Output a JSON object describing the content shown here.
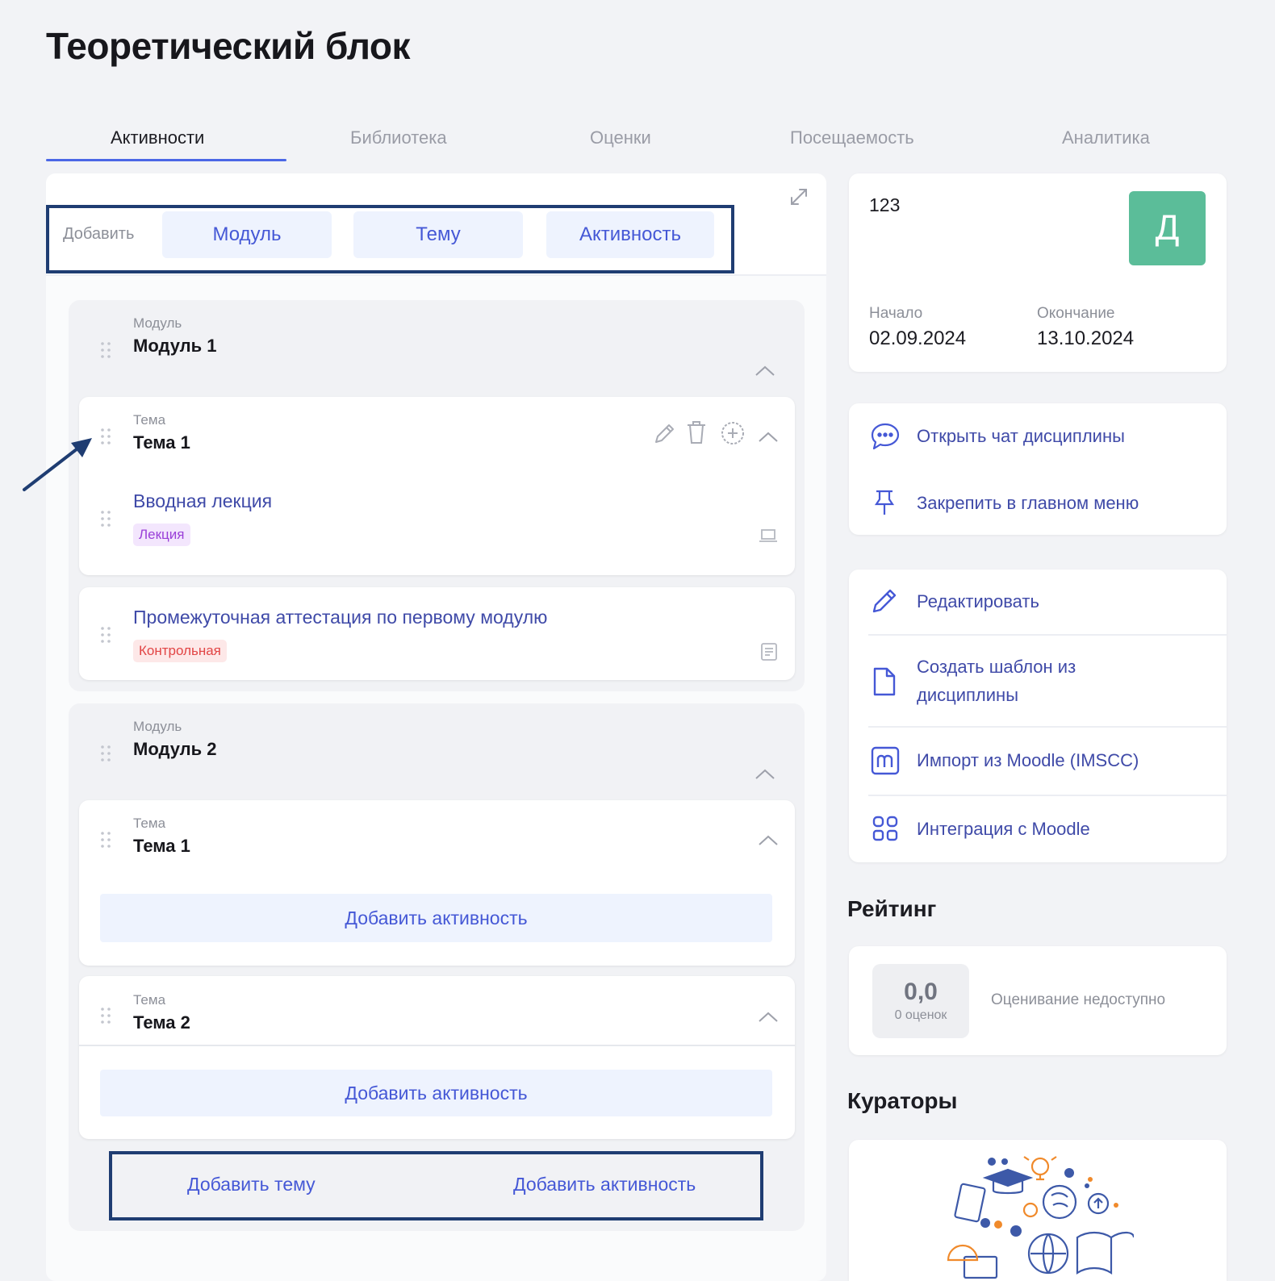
{
  "page": {
    "title": "Теоретический блок"
  },
  "tabs": [
    {
      "label": "Активности",
      "active": true
    },
    {
      "label": "Библиотека",
      "active": false
    },
    {
      "label": "Оценки",
      "active": false
    },
    {
      "label": "Посещаемость",
      "active": false
    },
    {
      "label": "Аналитика",
      "active": false
    }
  ],
  "add_bar": {
    "label": "Добавить",
    "module": "Модуль",
    "topic": "Тему",
    "activity": "Активность"
  },
  "modules": [
    {
      "caption": "Модуль",
      "name": "Модуль 1",
      "topic": {
        "caption": "Тема",
        "name": "Тема 1"
      },
      "activities": [
        {
          "title": "Вводная лекция",
          "tag": "Лекция"
        },
        {
          "title": "Промежуточная аттестация по первому модулю",
          "tag": "Контрольная"
        }
      ]
    },
    {
      "caption": "Модуль",
      "name": "Модуль 2",
      "topics": [
        {
          "caption": "Тема",
          "name": "Тема 1"
        },
        {
          "caption": "Тема",
          "name": "Тема 2"
        }
      ]
    }
  ],
  "add_activity_label": "Добавить активность",
  "module_footer": {
    "add_topic": "Добавить тему",
    "add_activity": "Добавить активность"
  },
  "course": {
    "name": "123",
    "avatar_letter": "Д",
    "avatar_color": "#5bbd99",
    "start_label": "Начало",
    "start_date": "02.09.2024",
    "end_label": "Окончание",
    "end_date": "13.10.2024"
  },
  "actions_top": [
    {
      "label": "Открыть чат дисциплины",
      "icon": "chat-icon"
    },
    {
      "label": "Закрепить в главном меню",
      "icon": "pin-icon"
    }
  ],
  "actions_bottom": [
    {
      "label": "Редактировать",
      "icon": "pencil-icon"
    },
    {
      "label": "Создать шаблон из",
      "label2": "дисциплины",
      "icon": "document-icon"
    },
    {
      "label": "Импорт из Moodle (IMSCC)",
      "icon": "moodle-icon"
    },
    {
      "label": "Интеграция с Moodle",
      "icon": "grid-icon"
    }
  ],
  "rating": {
    "title": "Рейтинг",
    "value": "0,0",
    "count": "0 оценок",
    "status": "Оценивание недоступно"
  },
  "curators": {
    "title": "Кураторы"
  },
  "colors": {
    "accent": "#4b67e6",
    "link": "#3f4aa8",
    "highlight_border": "#1f3d72"
  }
}
